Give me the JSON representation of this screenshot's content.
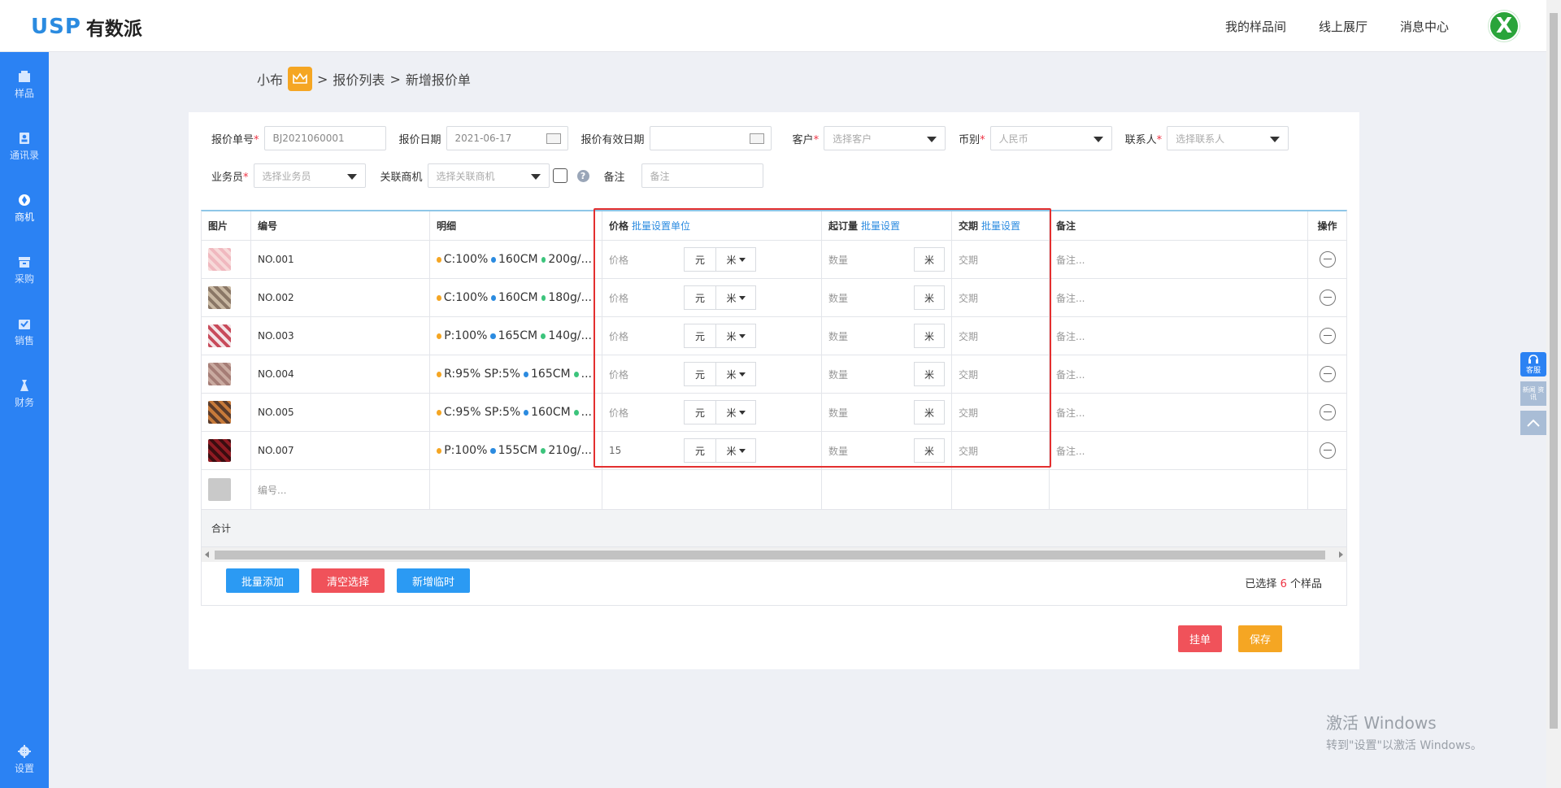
{
  "app": {
    "logo_usp": "USP",
    "logo_cn": "有数派",
    "avatar_letter": "X"
  },
  "topnav": [
    "我的样品间",
    "线上展厅",
    "消息中心"
  ],
  "sidebar": [
    {
      "label": "样品",
      "icon": "sample-icon"
    },
    {
      "label": "通讯录",
      "icon": "contacts-icon"
    },
    {
      "label": "商机",
      "icon": "opportunity-icon",
      "active": true
    },
    {
      "label": "采购",
      "icon": "purchase-icon"
    },
    {
      "label": "销售",
      "icon": "sales-icon"
    },
    {
      "label": "财务",
      "icon": "finance-icon"
    },
    {
      "label": "设置",
      "icon": "gear-icon"
    }
  ],
  "breadcrumb": {
    "user": "小布",
    "sep1": ">",
    "list": "报价列表",
    "sep2": ">",
    "current": "新增报价单"
  },
  "form": {
    "quote_no_label": "报价单号",
    "quote_no_value": "BJ2021060001",
    "quote_date_label": "报价日期",
    "quote_date_value": "2021-06-17",
    "valid_date_label": "报价有效日期",
    "valid_date_value": "",
    "customer_label": "客户",
    "customer_placeholder": "选择客户",
    "currency_label": "币别",
    "currency_placeholder": "人民币",
    "contact_label": "联系人",
    "contact_placeholder": "选择联系人",
    "salesman_label": "业务员",
    "salesman_placeholder": "选择业务员",
    "opportunity_label": "关联商机",
    "opportunity_placeholder": "选择关联商机",
    "help_mark": "?",
    "remark_label": "备注",
    "remark_placeholder": "备注"
  },
  "table": {
    "headers": {
      "image": "图片",
      "no": "编号",
      "detail": "明细",
      "price": "价格",
      "price_link": "批量设置单位",
      "moq": "起订量",
      "moq_link": "批量设置",
      "lead": "交期",
      "lead_link": "批量设置",
      "note": "备注",
      "op": "操作"
    },
    "rows": [
      {
        "no": "NO.001",
        "specs": [
          "C:100%",
          "160CM",
          "200g/..."
        ],
        "spec_colors": [
          "#f5a623",
          "#2b8be0",
          "#3cc47c"
        ],
        "price": "价格",
        "price_filled": false,
        "currency": "元",
        "unit": "米",
        "qty": "数量",
        "qty_unit": "米",
        "lead": "交期",
        "note": "备注...",
        "swatch": [
          "#f7d9d9",
          "#f0b8bf"
        ]
      },
      {
        "no": "NO.002",
        "specs": [
          "C:100%",
          "160CM",
          "180g/..."
        ],
        "spec_colors": [
          "#f5a623",
          "#2b8be0",
          "#3cc47c"
        ],
        "price": "价格",
        "price_filled": false,
        "currency": "元",
        "unit": "米",
        "qty": "数量",
        "qty_unit": "米",
        "lead": "交期",
        "note": "备注...",
        "swatch": [
          "#8a7766",
          "#c9b8a2"
        ]
      },
      {
        "no": "NO.003",
        "specs": [
          "P:100%",
          "165CM",
          "140g/..."
        ],
        "spec_colors": [
          "#f5a623",
          "#2b8be0",
          "#3cc47c"
        ],
        "price": "价格",
        "price_filled": false,
        "currency": "元",
        "unit": "米",
        "qty": "数量",
        "qty_unit": "米",
        "lead": "交期",
        "note": "备注...",
        "swatch": [
          "#c84a5a",
          "#f3e3e6"
        ]
      },
      {
        "no": "NO.004",
        "specs": [
          "R:95% SP:5%",
          "165CM",
          "..."
        ],
        "spec_colors": [
          "#f5a623",
          "#2b8be0",
          "#3cc47c"
        ],
        "price": "价格",
        "price_filled": false,
        "currency": "元",
        "unit": "米",
        "qty": "数量",
        "qty_unit": "米",
        "lead": "交期",
        "note": "备注...",
        "swatch": [
          "#a57d76",
          "#c9aaa0"
        ]
      },
      {
        "no": "NO.005",
        "specs": [
          "C:95% SP:5%",
          "160CM",
          "..."
        ],
        "spec_colors": [
          "#f5a623",
          "#2b8be0",
          "#3cc47c"
        ],
        "price": "价格",
        "price_filled": false,
        "currency": "元",
        "unit": "米",
        "qty": "数量",
        "qty_unit": "米",
        "lead": "交期",
        "note": "备注...",
        "swatch": [
          "#5a3b2a",
          "#c77a3a"
        ]
      },
      {
        "no": "NO.007",
        "specs": [
          "P:100%",
          "155CM",
          "210g/..."
        ],
        "spec_colors": [
          "#f5a623",
          "#2b8be0",
          "#3cc47c"
        ],
        "price": "15",
        "price_filled": true,
        "currency": "元",
        "unit": "米",
        "qty": "数量",
        "qty_unit": "米",
        "lead": "交期",
        "note": "备注...",
        "swatch": [
          "#8e1a22",
          "#3a0d10"
        ]
      }
    ],
    "new_row_placeholder": "编号...",
    "total_label": "合计"
  },
  "actions": {
    "batch_add": "批量添加",
    "clear": "清空选择",
    "add_temp": "新增临时",
    "selected_prefix": "已选择",
    "selected_count": "6",
    "selected_suffix": "个样品",
    "hold": "挂单",
    "save": "保存"
  },
  "float": {
    "service": "客服",
    "feedback": "新闻 资讯"
  },
  "watermark": {
    "line1": "激活 Windows",
    "line2": "转到\"设置\"以激活 Windows。"
  },
  "colors": {
    "primary": "#2b82f3",
    "danger": "#f0525a",
    "warning": "#f5a623",
    "link": "#2b8be0",
    "highlight_frame": "#e32f2f"
  }
}
